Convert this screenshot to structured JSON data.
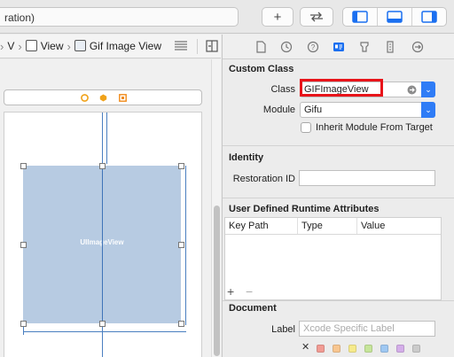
{
  "toolbar": {
    "scheme_text": "ration)",
    "add_icon": "plus-icon",
    "swap_icon": "arrows-swap-icon",
    "panels": [
      "navigator-panel-icon",
      "debug-panel-icon",
      "inspector-panel-icon"
    ]
  },
  "jumpbar": {
    "items": [
      "V",
      "View",
      "Gif Image View"
    ],
    "lines_icon": "lines-icon",
    "assistant_icon": "assistant-editor-icon"
  },
  "canvas": {
    "image_view_label": "UIImageView",
    "scene_icons": [
      "view-controller-icon",
      "first-responder-icon",
      "exit-icon"
    ]
  },
  "inspector": {
    "tabs": [
      "file-icon",
      "history-icon",
      "help-icon",
      "identity-icon",
      "attributes-icon",
      "size-icon",
      "connections-icon"
    ],
    "custom_class": {
      "title": "Custom Class",
      "class_label": "Class",
      "class_value": "GIFImageView",
      "module_label": "Module",
      "module_value": "Gifu",
      "inherit_label": "Inherit Module From Target"
    },
    "identity": {
      "title": "Identity",
      "restoration_label": "Restoration ID",
      "restoration_value": ""
    },
    "runtime_attributes": {
      "title": "User Defined Runtime Attributes",
      "columns": [
        "Key Path",
        "Type",
        "Value"
      ],
      "add_label": "+",
      "remove_label": "−"
    },
    "document": {
      "title": "Document",
      "label_label": "Label",
      "label_placeholder": "Xcode Specific Label",
      "clear_label": "✕",
      "swatches": [
        "#f19b93",
        "#f8c690",
        "#f6ea8b",
        "#c6e59a",
        "#9fc8f2",
        "#d4aee9",
        "#cbcbcb"
      ]
    }
  },
  "colors": {
    "accent": "#2f7cf6",
    "highlight": "#e8141a",
    "image_view": "#b7cbe2"
  }
}
